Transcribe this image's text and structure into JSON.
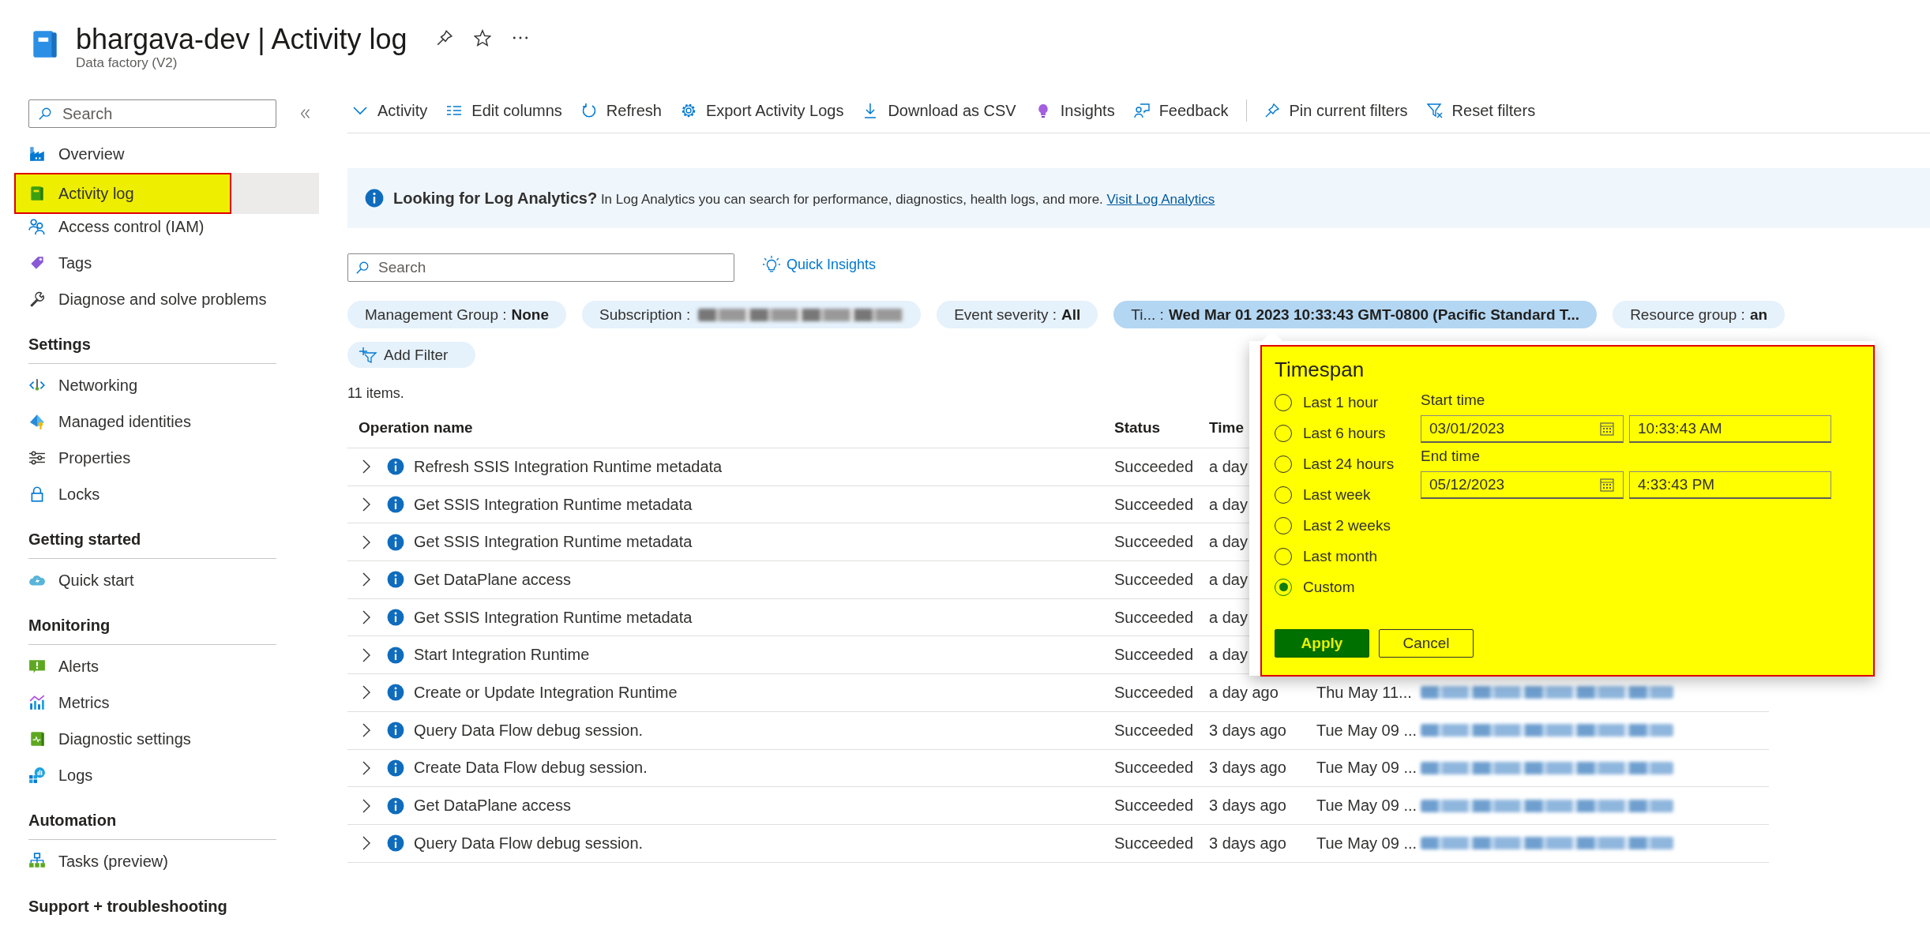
{
  "header": {
    "title": "bhargava-dev | Activity log",
    "subtitle": "Data factory (V2)"
  },
  "sidebar": {
    "search": {
      "placeholder": "Search"
    },
    "groups": [
      {
        "items": [
          {
            "label": "Overview",
            "selected": false,
            "highlighted": false
          },
          {
            "label": "Activity log",
            "selected": true,
            "highlighted": true
          },
          {
            "label": "Access control (IAM)",
            "selected": false,
            "highlighted": false
          },
          {
            "label": "Tags",
            "selected": false,
            "highlighted": false
          },
          {
            "label": "Diagnose and solve problems",
            "selected": false,
            "highlighted": false
          }
        ]
      },
      {
        "heading": "Settings",
        "items": [
          {
            "label": "Networking",
            "selected": false,
            "highlighted": false
          },
          {
            "label": "Managed identities",
            "selected": false,
            "highlighted": false
          },
          {
            "label": "Properties",
            "selected": false,
            "highlighted": false
          },
          {
            "label": "Locks",
            "selected": false,
            "highlighted": false
          }
        ]
      },
      {
        "heading": "Getting started",
        "items": [
          {
            "label": "Quick start",
            "selected": false,
            "highlighted": false
          }
        ]
      },
      {
        "heading": "Monitoring",
        "items": [
          {
            "label": "Alerts",
            "selected": false,
            "highlighted": false
          },
          {
            "label": "Metrics",
            "selected": false,
            "highlighted": false
          },
          {
            "label": "Diagnostic settings",
            "selected": false,
            "highlighted": false
          },
          {
            "label": "Logs",
            "selected": false,
            "highlighted": false
          }
        ]
      },
      {
        "heading": "Automation",
        "items": [
          {
            "label": "Tasks (preview)",
            "selected": false,
            "highlighted": false
          }
        ]
      },
      {
        "heading": "Support + troubleshooting"
      }
    ]
  },
  "toolbar": [
    {
      "label": "Activity",
      "separator_before": false
    },
    {
      "label": "Edit columns",
      "separator_before": false
    },
    {
      "label": "Refresh",
      "separator_before": false
    },
    {
      "label": "Export Activity Logs",
      "separator_before": false
    },
    {
      "label": "Download as CSV",
      "separator_before": false
    },
    {
      "label": "Insights",
      "separator_before": false
    },
    {
      "label": "Feedback",
      "separator_before": false
    },
    {
      "label": "Pin current filters",
      "separator_before": true
    },
    {
      "label": "Reset filters",
      "separator_before": false
    }
  ],
  "banner": {
    "text": "**Looking for Log Analytics?** In Log Analytics you can search for performance, diagnostics, health logs, and more.",
    "link": "Visit Log Analytics"
  },
  "search": {
    "placeholder": "Search"
  },
  "quick_insights": "Quick Insights",
  "filters": [
    {
      "label": "Management Group :",
      "value": "None",
      "value_blurred": false,
      "selected": false
    },
    {
      "label": "Subscription :",
      "value_blurred": true,
      "selected": false
    },
    {
      "label": "Event severity :",
      "value": "All",
      "value_blurred": false,
      "selected": false
    },
    {
      "label": "Ti...  :",
      "value": "Wed Mar 01 2023 10:33:43 GMT-0800 (Pacific Standard T...",
      "value_blurred": false,
      "selected": true
    },
    {
      "label": "Resource group :",
      "value": "an",
      "value_blurred": false,
      "selected": false
    }
  ],
  "add_filter": "Add Filter",
  "item_count": "11 items.",
  "table": {
    "columns": [
      "Operation name",
      "Status",
      "Time"
    ],
    "rows": [
      {
        "operation": "Refresh SSIS Integration Runtime metadata",
        "status": "Succeeded",
        "time": "a day"
      },
      {
        "operation": "Get SSIS Integration Runtime metadata",
        "status": "Succeeded",
        "time": "a day"
      },
      {
        "operation": "Get SSIS Integration Runtime metadata",
        "status": "Succeeded",
        "time": "a day"
      },
      {
        "operation": "Get DataPlane access",
        "status": "Succeeded",
        "time": "a day"
      },
      {
        "operation": "Get SSIS Integration Runtime metadata",
        "status": "Succeeded",
        "time": "a day"
      },
      {
        "operation": "Start Integration Runtime",
        "status": "Succeeded",
        "time": "a day"
      },
      {
        "operation": "Create or Update Integration Runtime",
        "status": "Succeeded",
        "time": "a day ago",
        "timestamp": "Thu May 11...",
        "subscription_blurred": true
      },
      {
        "operation": "Query Data Flow debug session.",
        "status": "Succeeded",
        "time": "3 days ago",
        "timestamp": "Tue May 09 ...",
        "subscription_blurred": true
      },
      {
        "operation": "Create Data Flow debug session.",
        "status": "Succeeded",
        "time": "3 days ago",
        "timestamp": "Tue May 09 ...",
        "subscription_blurred": true
      },
      {
        "operation": "Get DataPlane access",
        "status": "Succeeded",
        "time": "3 days ago",
        "timestamp": "Tue May 09 ...",
        "subscription_blurred": true
      },
      {
        "operation": "Query Data Flow debug session.",
        "status": "Succeeded",
        "time": "3 days ago",
        "timestamp": "Tue May 09 ...",
        "subscription_blurred": true
      }
    ]
  },
  "timespan": {
    "title": "Timespan",
    "highlighted": true,
    "options": [
      {
        "label": "Last 1 hour",
        "selected": false
      },
      {
        "label": "Last 6 hours",
        "selected": false
      },
      {
        "label": "Last 24 hours",
        "selected": false
      },
      {
        "label": "Last week",
        "selected": false
      },
      {
        "label": "Last 2 weeks",
        "selected": false
      },
      {
        "label": "Last month",
        "selected": false
      },
      {
        "label": "Custom",
        "selected": true
      }
    ],
    "start_label": "Start time",
    "start_date": "03/01/2023",
    "start_time": "10:33:43 AM",
    "end_label": "End time",
    "end_date": "05/12/2023",
    "end_time": "4:33:43 PM",
    "buttons": [
      {
        "label": "Apply",
        "kind": "primary"
      },
      {
        "label": "Cancel",
        "kind": "secondary"
      }
    ]
  }
}
